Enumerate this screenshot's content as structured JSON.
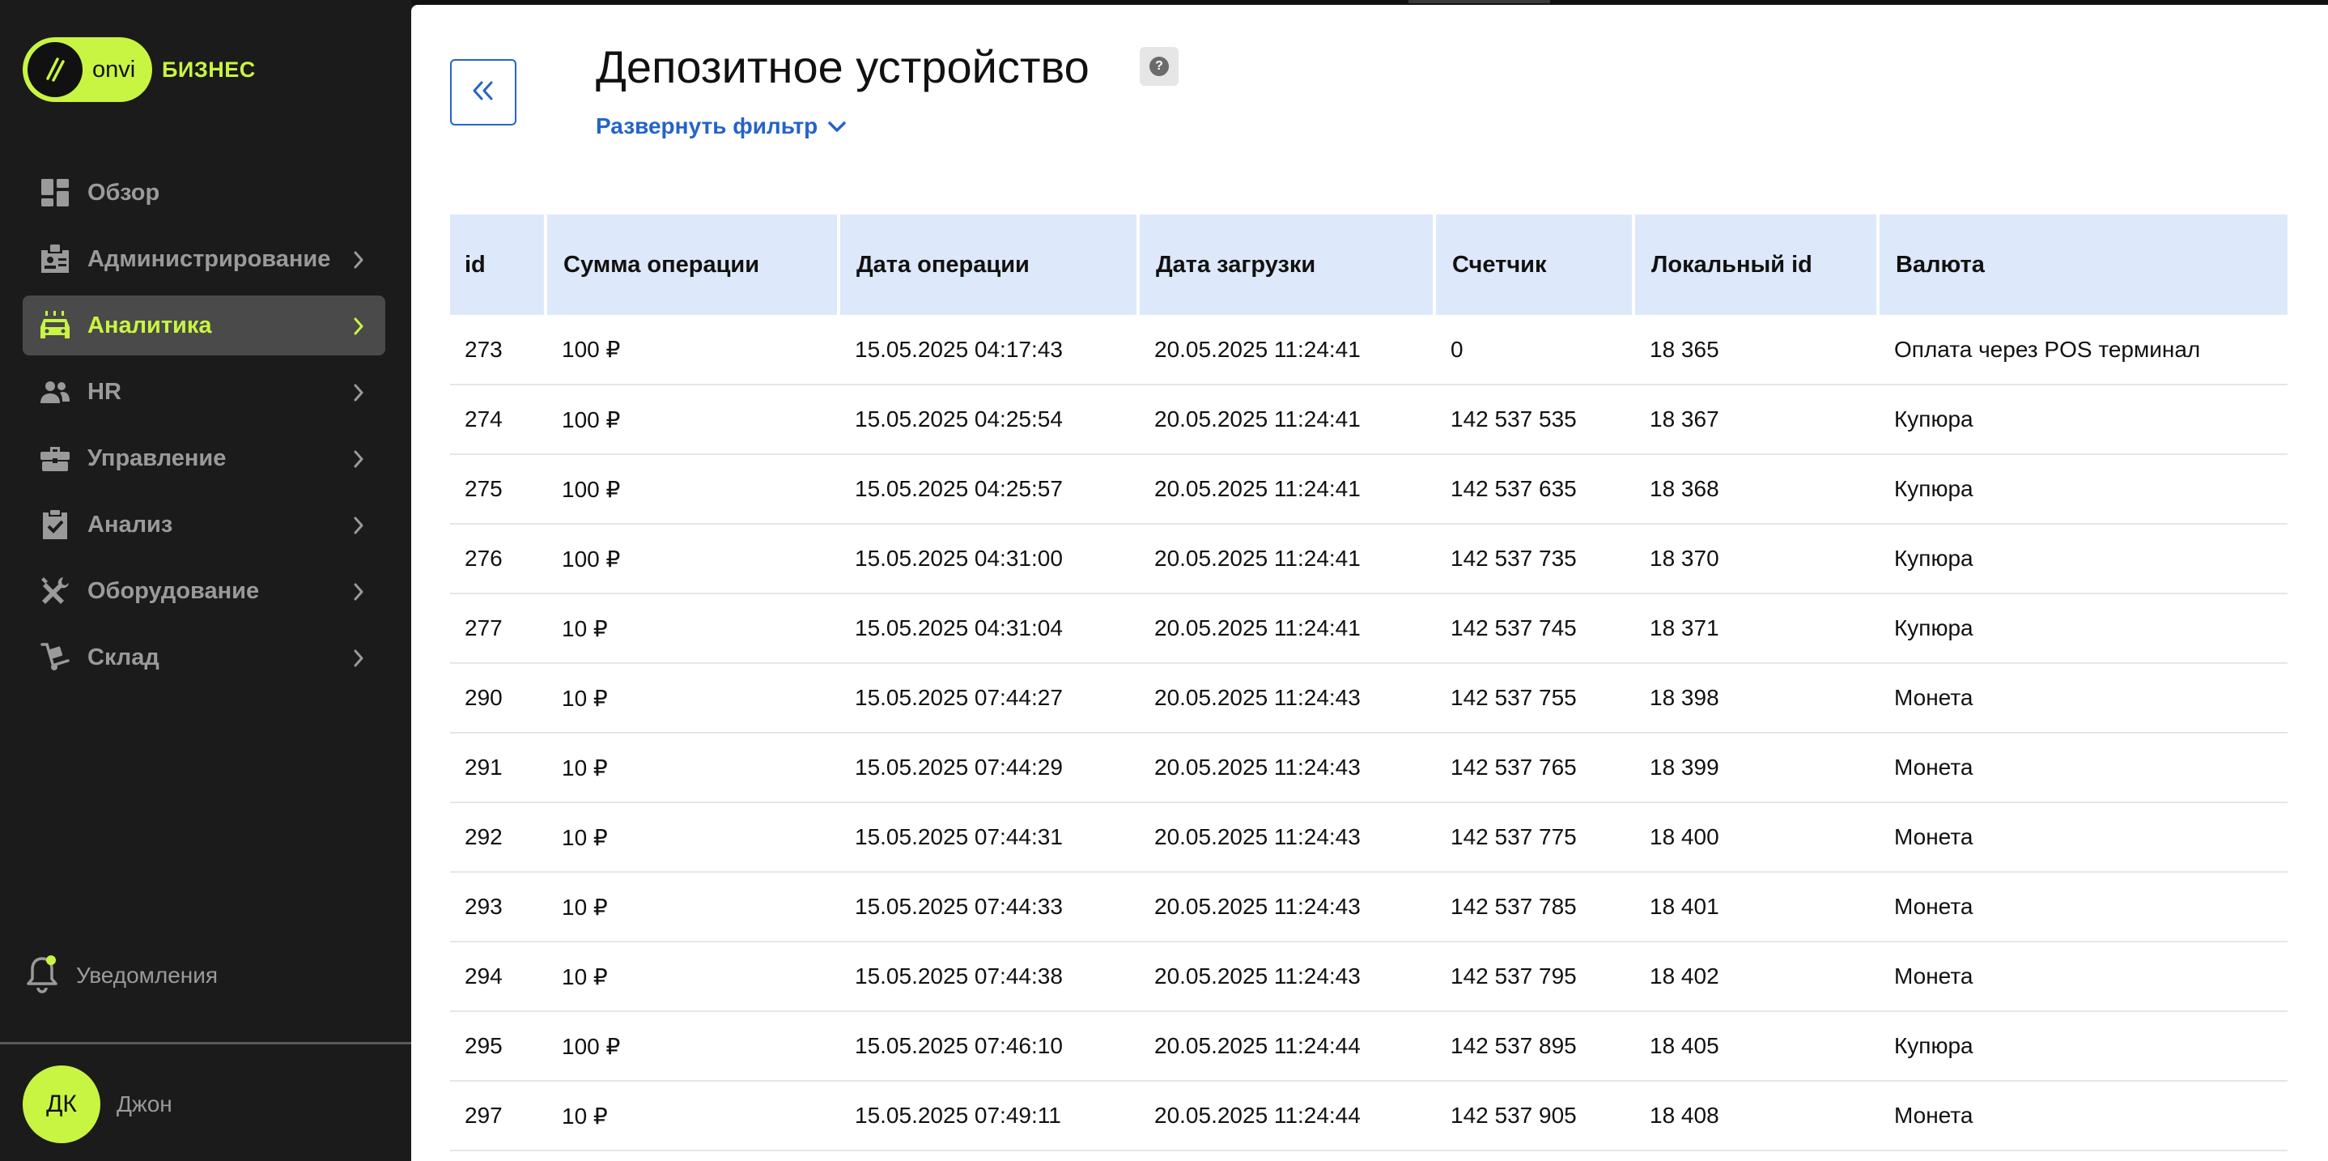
{
  "app": {
    "logo_word": "onvi",
    "logo_suffix": "БИЗНЕС",
    "accent_color": "#c8f542",
    "link_color": "#2563c9"
  },
  "sidebar": {
    "items": [
      {
        "label": "Обзор",
        "icon": "dashboard-icon",
        "has_chevron": false,
        "active": false
      },
      {
        "label": "Администрирование",
        "icon": "id-badge-icon",
        "has_chevron": true,
        "active": false
      },
      {
        "label": "Аналитика",
        "icon": "car-analytics-icon",
        "has_chevron": true,
        "active": true
      },
      {
        "label": "HR",
        "icon": "people-icon",
        "has_chevron": true,
        "active": false
      },
      {
        "label": "Управление",
        "icon": "briefcase-icon",
        "has_chevron": true,
        "active": false
      },
      {
        "label": "Анализ",
        "icon": "clipboard-check-icon",
        "has_chevron": true,
        "active": false
      },
      {
        "label": "Оборудование",
        "icon": "tools-icon",
        "has_chevron": true,
        "active": false
      },
      {
        "label": "Склад",
        "icon": "hand-truck-icon",
        "has_chevron": true,
        "active": false
      }
    ],
    "notifications_label": "Уведомления",
    "user_initials": "ДК",
    "user_name": "Джон"
  },
  "main": {
    "title": "Депозитное устройство",
    "filter_toggle_label": "Развернуть фильтр",
    "table": {
      "columns": [
        "id",
        "Сумма операции",
        "Дата операции",
        "Дата загрузки",
        "Счетчик",
        "Локальный id",
        "Валюта"
      ],
      "rows": [
        [
          "273",
          "100 ₽",
          "15.05.2025 04:17:43",
          "20.05.2025 11:24:41",
          "0",
          "18 365",
          "Оплата через POS терминал"
        ],
        [
          "274",
          "100 ₽",
          "15.05.2025 04:25:54",
          "20.05.2025 11:24:41",
          "142 537 535",
          "18 367",
          "Купюра"
        ],
        [
          "275",
          "100 ₽",
          "15.05.2025 04:25:57",
          "20.05.2025 11:24:41",
          "142 537 635",
          "18 368",
          "Купюра"
        ],
        [
          "276",
          "100 ₽",
          "15.05.2025 04:31:00",
          "20.05.2025 11:24:41",
          "142 537 735",
          "18 370",
          "Купюра"
        ],
        [
          "277",
          "10 ₽",
          "15.05.2025 04:31:04",
          "20.05.2025 11:24:41",
          "142 537 745",
          "18 371",
          "Купюра"
        ],
        [
          "290",
          "10 ₽",
          "15.05.2025 07:44:27",
          "20.05.2025 11:24:43",
          "142 537 755",
          "18 398",
          "Монета"
        ],
        [
          "291",
          "10 ₽",
          "15.05.2025 07:44:29",
          "20.05.2025 11:24:43",
          "142 537 765",
          "18 399",
          "Монета"
        ],
        [
          "292",
          "10 ₽",
          "15.05.2025 07:44:31",
          "20.05.2025 11:24:43",
          "142 537 775",
          "18 400",
          "Монета"
        ],
        [
          "293",
          "10 ₽",
          "15.05.2025 07:44:33",
          "20.05.2025 11:24:43",
          "142 537 785",
          "18 401",
          "Монета"
        ],
        [
          "294",
          "10 ₽",
          "15.05.2025 07:44:38",
          "20.05.2025 11:24:43",
          "142 537 795",
          "18 402",
          "Монета"
        ],
        [
          "295",
          "100 ₽",
          "15.05.2025 07:46:10",
          "20.05.2025 11:24:44",
          "142 537 895",
          "18 405",
          "Купюра"
        ],
        [
          "297",
          "10 ₽",
          "15.05.2025 07:49:11",
          "20.05.2025 11:24:44",
          "142 537 905",
          "18 408",
          "Монета"
        ]
      ]
    }
  }
}
